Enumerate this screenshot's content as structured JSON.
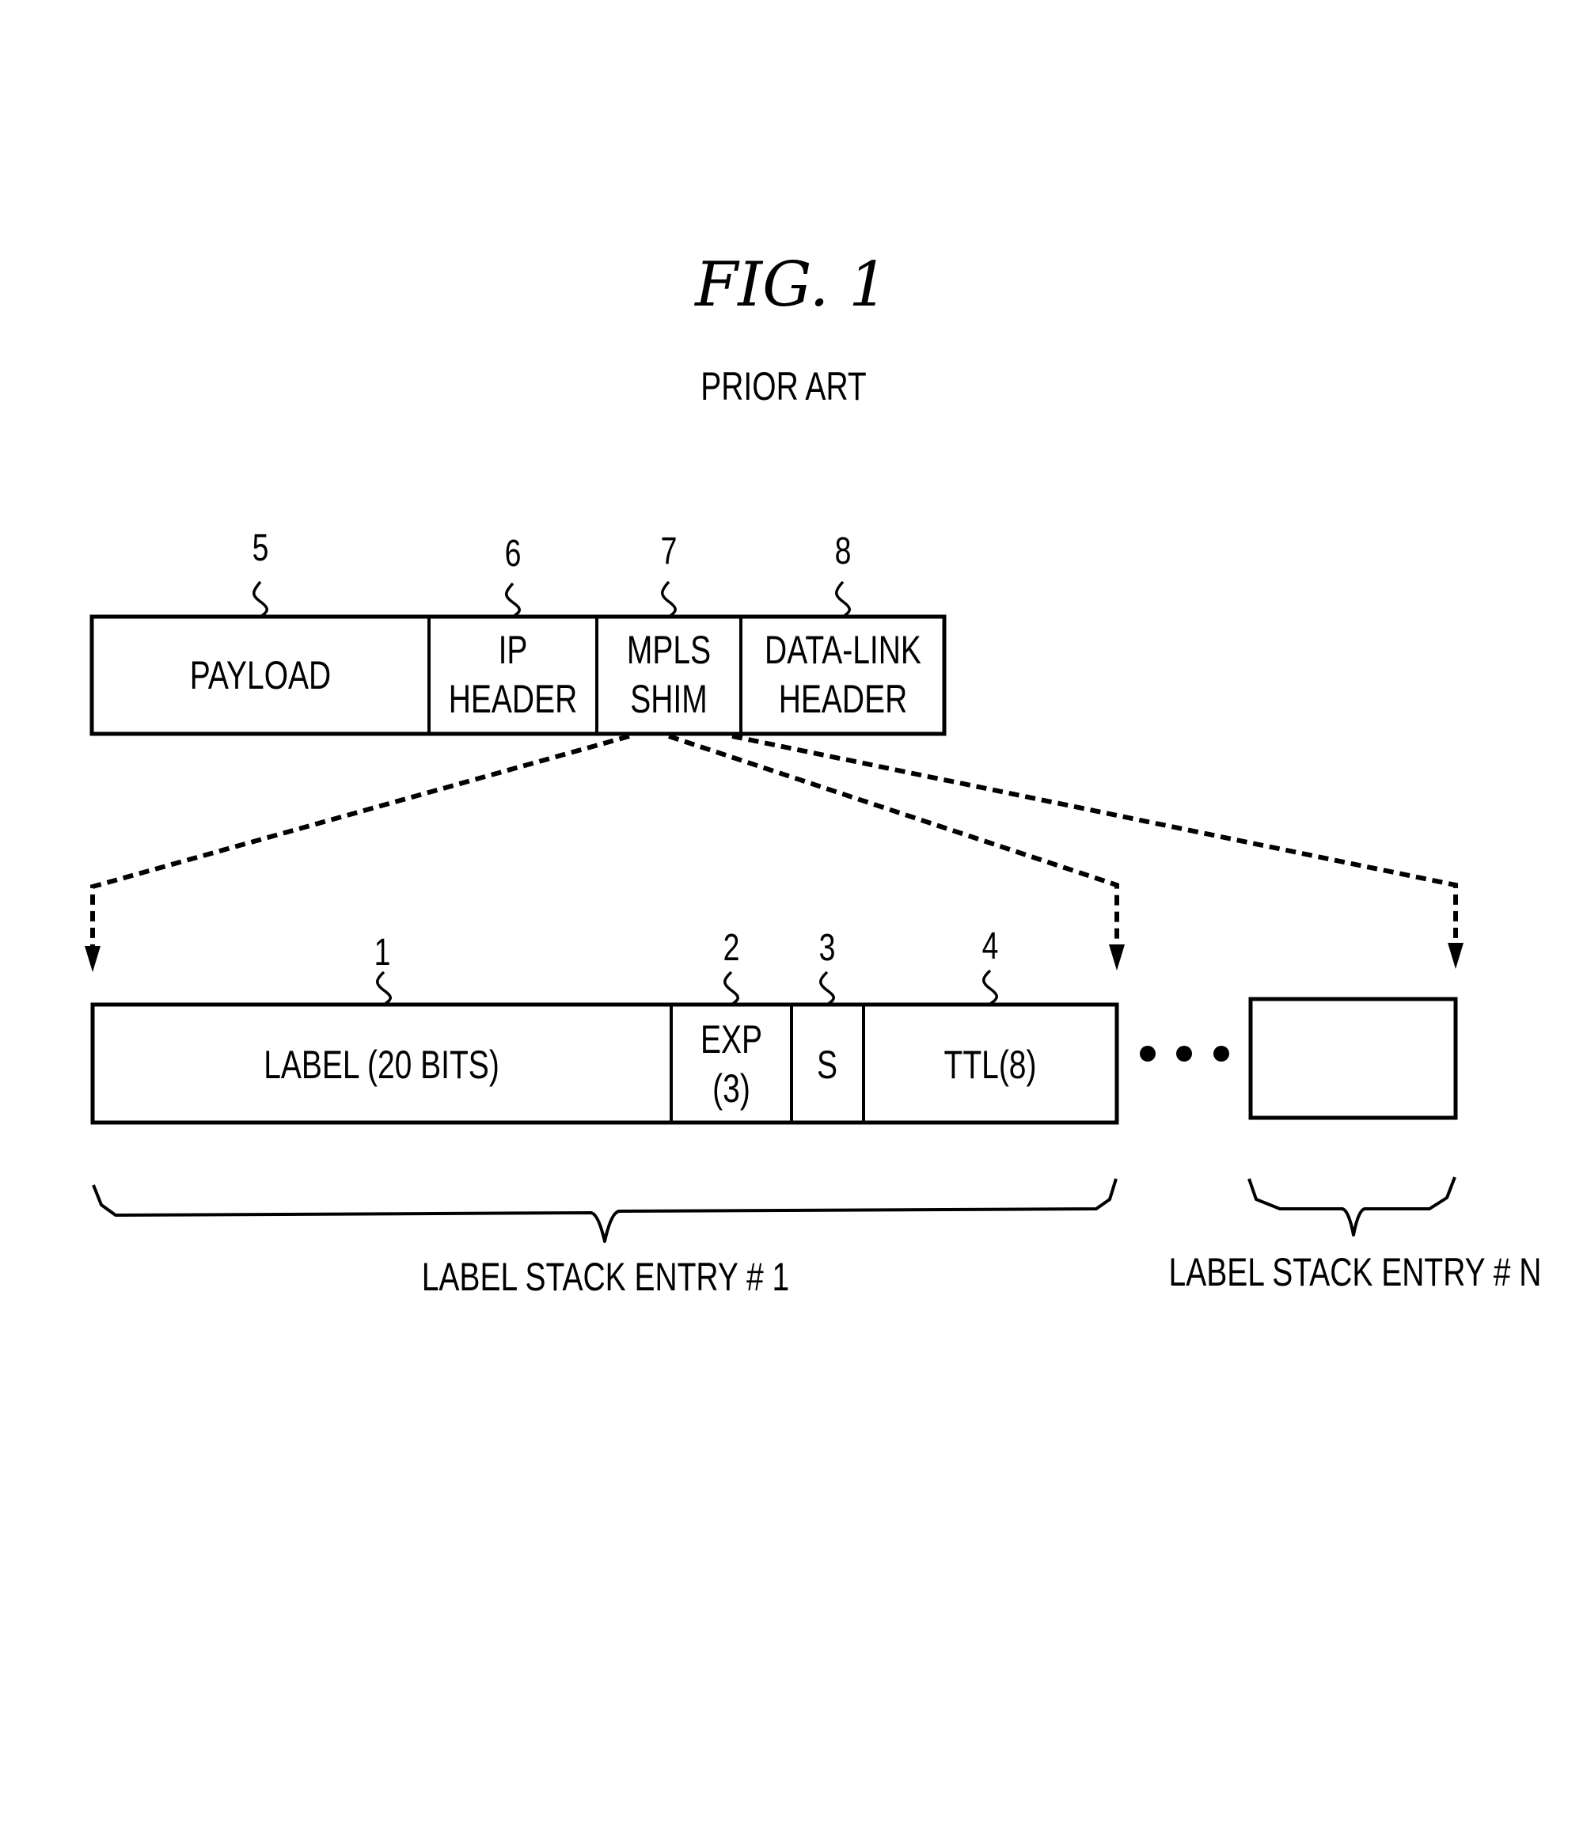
{
  "figure": {
    "title": "FIG.  1",
    "subtitle": "PRIOR ART"
  },
  "packet": {
    "fields": [
      {
        "ref": "5",
        "lines": [
          "PAYLOAD"
        ]
      },
      {
        "ref": "6",
        "lines": [
          "IP",
          "HEADER"
        ]
      },
      {
        "ref": "7",
        "lines": [
          "MPLS",
          "SHIM"
        ]
      },
      {
        "ref": "8",
        "lines": [
          "DATA-LINK",
          "HEADER"
        ]
      }
    ]
  },
  "label_stack_entry": {
    "fields": [
      {
        "ref": "1",
        "lines": [
          "LABEL (20 BITS)"
        ]
      },
      {
        "ref": "2",
        "lines": [
          "EXP",
          "(3)"
        ]
      },
      {
        "ref": "3",
        "lines": [
          "S"
        ]
      },
      {
        "ref": "4",
        "lines": [
          "TTL(8)"
        ]
      }
    ],
    "ellipsis": "• • •",
    "brace_labels": [
      "LABEL STACK ENTRY # 1",
      "LABEL STACK ENTRY # N"
    ]
  }
}
